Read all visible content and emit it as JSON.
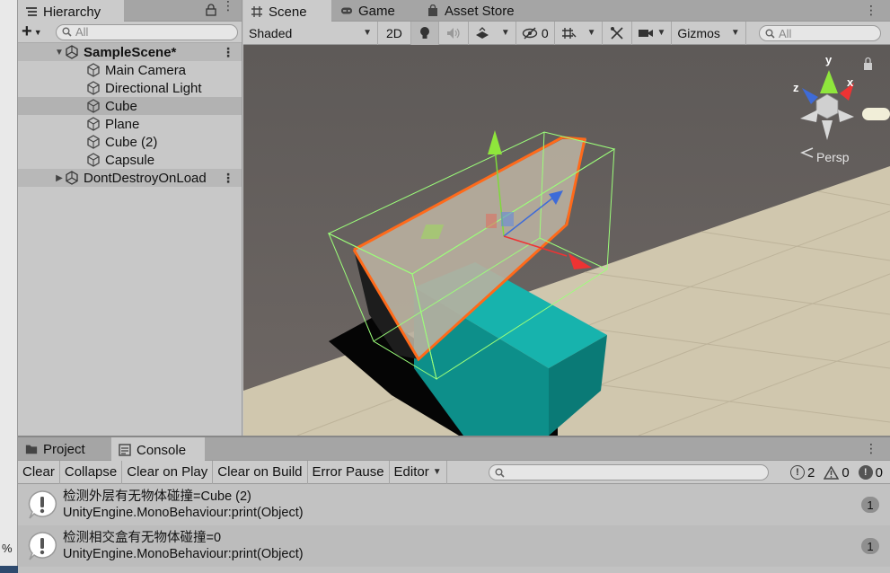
{
  "left_strip": {
    "percent_label": "%"
  },
  "hierarchy": {
    "tab_label": "Hierarchy",
    "search_placeholder": "All",
    "scene_name": "SampleScene*",
    "objects": [
      "Main Camera",
      "Directional Light",
      "Cube",
      "Plane",
      "Cube (2)",
      "Capsule"
    ],
    "selected": "Cube",
    "dont_destroy": "DontDestroyOnLoad"
  },
  "scene_tabs": {
    "scene": "Scene",
    "game": "Game",
    "asset_store": "Asset Store"
  },
  "scene_toolbar": {
    "draw_mode": "Shaded",
    "mode_2d": "2D",
    "hidden_count": "0",
    "gizmos": "Gizmos",
    "search_placeholder": "All"
  },
  "viewport": {
    "projection": "Persp",
    "axis_x": "x",
    "axis_y": "y",
    "axis_z": "z"
  },
  "bottom_tabs": {
    "project": "Project",
    "console": "Console"
  },
  "console_toolbar": {
    "clear": "Clear",
    "collapse": "Collapse",
    "clear_on_play": "Clear on Play",
    "clear_on_build": "Clear on Build",
    "error_pause": "Error Pause",
    "editor": "Editor",
    "log_count": "2",
    "warning_count": "0",
    "error_count": "0"
  },
  "console_logs": [
    {
      "message": "检测外层有无物体碰撞=Cube (2)",
      "stack": "UnityEngine.MonoBehaviour:print(Object)",
      "count": "1"
    },
    {
      "message": "检测相交盒有无物体碰撞=0",
      "stack": "UnityEngine.MonoBehaviour:print(Object)",
      "count": "1"
    }
  ],
  "colors": {
    "selection_outline": "#ff6a1a",
    "collider_wire": "#9cff7a",
    "cube_teal": "#16a6a0",
    "ground": "#cfc6ad",
    "sky": "#5b5756"
  }
}
